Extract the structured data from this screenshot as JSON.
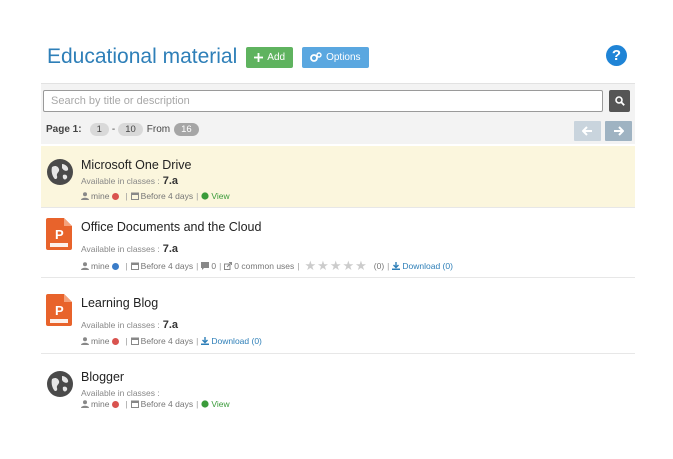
{
  "header": {
    "title": "Educational material",
    "add_label": "Add",
    "options_label": "Options",
    "help_label": "?"
  },
  "search": {
    "placeholder": "Search by title or description"
  },
  "pager": {
    "page_label": "Page 1:",
    "range_start": "1",
    "dash": "-",
    "range_end": "10",
    "from_label": "From",
    "total": "16"
  },
  "items": [
    {
      "title": "Microsoft One Drive",
      "classes_label": "Available in classes :",
      "classes_value": "7.a",
      "owner": "mine",
      "date": "Before 4 days",
      "view_label": "View",
      "icon": "globe-icon"
    },
    {
      "title": "Office Documents and the Cloud",
      "classes_label": "Available in classes :",
      "classes_value": "7.a",
      "owner": "mine",
      "date": "Before 4 days",
      "comments": "0",
      "common_uses": "0 common uses",
      "rating_count": "(0)",
      "download_label": "Download (0)",
      "icon": "ppt-file-icon"
    },
    {
      "title": "Learning Blog",
      "classes_label": "Available in classes :",
      "classes_value": "7.a",
      "owner": "mine",
      "date": "Before 4 days",
      "download_label": "Download (0)",
      "icon": "ppt-file-icon"
    },
    {
      "title": "Blogger",
      "classes_label": "Available in classes :",
      "classes_value": "",
      "owner": "mine",
      "date": "Before 4 days",
      "view_label": "View",
      "icon": "globe-icon"
    }
  ],
  "colors": {
    "title": "#2e7fb8",
    "add_button": "#5fb35f",
    "options_button": "#5aa7e0",
    "help": "#1f84d6",
    "highlight_row": "#fbf6dd",
    "ppt_orange": "#e8632b"
  }
}
